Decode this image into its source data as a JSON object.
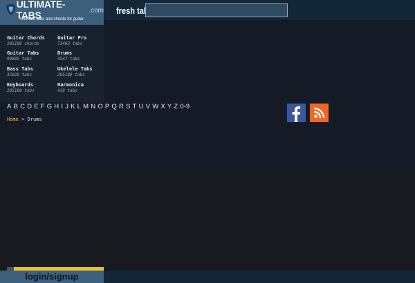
{
  "header": {
    "logo_text": "ULTIMATE-TABS",
    "logo_suffix": ".com",
    "tagline": "Ultimate tabs and chords for guitar",
    "fresh_label": "fresh tab",
    "search": {
      "value": "",
      "placeholder": ""
    }
  },
  "categories": [
    {
      "name": "Guitar Chords",
      "count": "285189 chords"
    },
    {
      "name": "Guitar Pro",
      "count": "73493 tabs"
    },
    {
      "name": "Guitar Tabs",
      "count": "99885 tabs"
    },
    {
      "name": "Drums",
      "count": "4547 tabs"
    },
    {
      "name": "Bass Tabs",
      "count": "32029 tabs"
    },
    {
      "name": "Ukelele Tabs",
      "count": "285189 tabs"
    },
    {
      "name": "Keyboards",
      "count": "285189 tabs"
    },
    {
      "name": "Harmonica",
      "count": "419 tabs"
    }
  ],
  "alphabet": [
    "A",
    "B",
    "C",
    "D",
    "E",
    "F",
    "G",
    "H",
    "I",
    "J",
    "K",
    "L",
    "M",
    "N",
    "O",
    "P",
    "Q",
    "R",
    "S",
    "T",
    "U",
    "V",
    "W",
    "X",
    "Y",
    "Z",
    "0-9"
  ],
  "breadcrumb": {
    "home": "Home",
    "separator": ">",
    "current": "Drums"
  },
  "social": {
    "facebook_icon": "facebook-icon",
    "rss_icon": "rss-icon"
  },
  "footer": {
    "login_label": "login/signup"
  },
  "colors": {
    "header_bg": "#132738",
    "logo_bg": "#3b5f7d",
    "accent": "#f2c021",
    "link": "#ffbf2b",
    "facebook": "#3b5998",
    "rss": "#f26522"
  }
}
